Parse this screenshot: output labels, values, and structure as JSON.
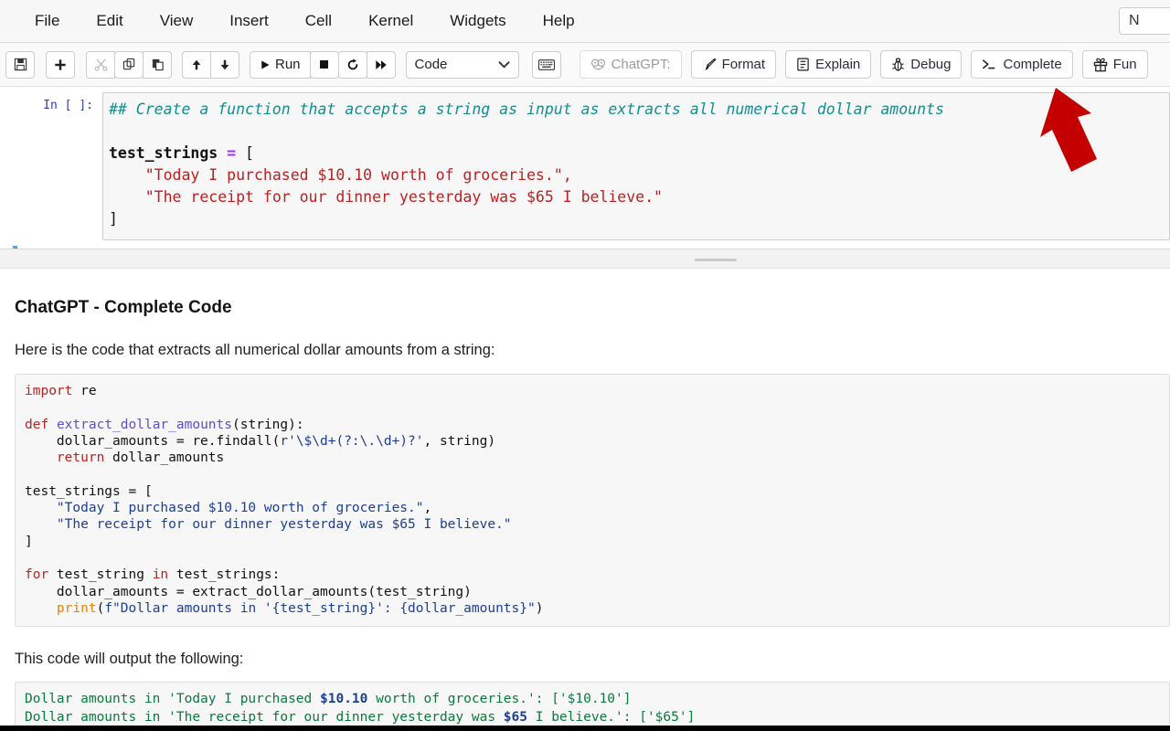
{
  "window": {
    "title": "Jupyter Notebook"
  },
  "menubar": {
    "items": [
      {
        "label": "File",
        "name": "menu-file"
      },
      {
        "label": "Edit",
        "name": "menu-edit"
      },
      {
        "label": "View",
        "name": "menu-view"
      },
      {
        "label": "Insert",
        "name": "menu-insert"
      },
      {
        "label": "Cell",
        "name": "menu-cell"
      },
      {
        "label": "Kernel",
        "name": "menu-kernel"
      },
      {
        "label": "Widgets",
        "name": "menu-widgets"
      },
      {
        "label": "Help",
        "name": "menu-help"
      }
    ],
    "trust_label": "N"
  },
  "toolbar": {
    "save_title": "Save",
    "insert_title": "Insert cell below",
    "cut_title": "Cut",
    "copy_title": "Copy",
    "paste_title": "Paste",
    "up_title": "Move up",
    "down_title": "Move down",
    "run_label": "Run",
    "stop_title": "Interrupt kernel",
    "restart_title": "Restart kernel",
    "restart_run_all_title": "Restart and run all",
    "cell_type": "Code",
    "keyboard_title": "Open command palette",
    "extension": {
      "brand_label": "ChatGPT:",
      "buttons": [
        {
          "label": "Format",
          "icon": "brush-icon",
          "name": "format-button"
        },
        {
          "label": "Explain",
          "icon": "document-icon",
          "name": "explain-button"
        },
        {
          "label": "Debug",
          "icon": "bug-icon",
          "name": "debug-button"
        },
        {
          "label": "Complete",
          "icon": "terminal-icon",
          "name": "complete-button"
        },
        {
          "label": "Fun",
          "icon": "gift-icon",
          "name": "fun-button"
        }
      ]
    }
  },
  "notebook": {
    "prompt": "In [ ]:",
    "code": {
      "comment": "## Create a function that accepts a string as input as extracts all numerical dollar amounts",
      "var_name": "test_strings",
      "assign_op": "=",
      "open_bracket": "[",
      "string1": "\"Today I purchased $10.10 worth of groceries.\",",
      "string2": "\"The receipt for our dinner yesterday was $65 I believe.\"",
      "close_bracket": "]"
    }
  },
  "annotation": {
    "arrow_color": "#C40000",
    "points_to": "complete-button"
  },
  "gpt_panel": {
    "title": "ChatGPT - Complete Code",
    "intro": "Here is the code that extracts all numerical dollar amounts from a string:",
    "outro": "This code will output the following:",
    "code_lines": [
      {
        "segments": [
          {
            "t": "import",
            "c": "k-kw"
          },
          {
            "t": " re",
            "c": "k-plain"
          }
        ]
      },
      {
        "segments": [
          {
            "t": "",
            "c": "k-plain"
          }
        ]
      },
      {
        "segments": [
          {
            "t": "def",
            "c": "k-def"
          },
          {
            "t": " ",
            "c": "k-plain"
          },
          {
            "t": "extract_dollar_amounts",
            "c": "k-fn"
          },
          {
            "t": "(string):",
            "c": "k-plain"
          }
        ]
      },
      {
        "segments": [
          {
            "t": "    dollar_amounts = re.findall(",
            "c": "k-plain"
          },
          {
            "t": "r'\\$\\d+(?:\\.\\d+)?'",
            "c": "k-str"
          },
          {
            "t": ", string)",
            "c": "k-plain"
          }
        ]
      },
      {
        "segments": [
          {
            "t": "    ",
            "c": "k-plain"
          },
          {
            "t": "return",
            "c": "k-kw"
          },
          {
            "t": " dollar_amounts",
            "c": "k-plain"
          }
        ]
      },
      {
        "segments": [
          {
            "t": "",
            "c": "k-plain"
          }
        ]
      },
      {
        "segments": [
          {
            "t": "test_strings = [",
            "c": "k-plain"
          }
        ]
      },
      {
        "segments": [
          {
            "t": "    ",
            "c": "k-plain"
          },
          {
            "t": "\"Today I purchased $10.10 worth of groceries.\"",
            "c": "k-str"
          },
          {
            "t": ",",
            "c": "k-plain"
          }
        ]
      },
      {
        "segments": [
          {
            "t": "    ",
            "c": "k-plain"
          },
          {
            "t": "\"The receipt for our dinner yesterday was $65 I believe.\"",
            "c": "k-str"
          }
        ]
      },
      {
        "segments": [
          {
            "t": "]",
            "c": "k-plain"
          }
        ]
      },
      {
        "segments": [
          {
            "t": "",
            "c": "k-plain"
          }
        ]
      },
      {
        "segments": [
          {
            "t": "for",
            "c": "k-kw"
          },
          {
            "t": " test_string ",
            "c": "k-plain"
          },
          {
            "t": "in",
            "c": "k-kw"
          },
          {
            "t": " test_strings:",
            "c": "k-plain"
          }
        ]
      },
      {
        "segments": [
          {
            "t": "    dollar_amounts = extract_dollar_amounts(test_string)",
            "c": "k-plain"
          }
        ]
      },
      {
        "segments": [
          {
            "t": "    ",
            "c": "k-plain"
          },
          {
            "t": "print",
            "c": "k-bi"
          },
          {
            "t": "(",
            "c": "k-plain"
          },
          {
            "t": "f\"Dollar amounts in '{test_string}': {dollar_amounts}\"",
            "c": "k-str"
          },
          {
            "t": ")",
            "c": "k-plain"
          }
        ]
      }
    ],
    "output_lines": [
      {
        "segments": [
          {
            "t": "Dollar amounts in 'Today I purchased ",
            "c": "o-txt"
          },
          {
            "t": "$10.10",
            "c": "o-num"
          },
          {
            "t": " worth of groceries.': ['$10.10']",
            "c": "o-txt"
          }
        ]
      },
      {
        "segments": [
          {
            "t": "Dollar amounts in 'The receipt for our dinner yesterday was ",
            "c": "o-txt"
          },
          {
            "t": "$65",
            "c": "o-num"
          },
          {
            "t": " I believe.': ['$65']",
            "c": "o-txt"
          }
        ]
      }
    ]
  },
  "colors": {
    "selection_bar": "#42A5F5",
    "comment": "#128F8F",
    "string_red": "#BA2121",
    "output_green": "#0B7A3B",
    "arrow_red": "#C40000"
  }
}
